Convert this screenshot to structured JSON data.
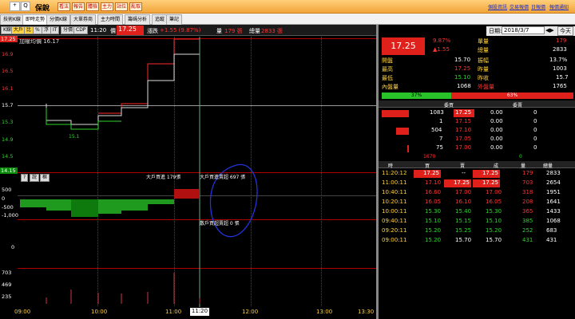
{
  "top": {
    "stock_ctrl": "+",
    "search": "Q",
    "name": "保銳",
    "fn_buttons": [
      "看法",
      "報告",
      "體檢",
      "主力",
      "站位",
      "亂取"
    ],
    "links": [
      "個股資訊",
      "交易報價",
      "日報價",
      "報價通知"
    ]
  },
  "tabs": [
    "技術K線",
    "即時走勢",
    "分價K線",
    "大單券商",
    "主力時間",
    "籌碼分析",
    "追蹤",
    "筆記"
  ],
  "toolbar": {
    "k": "K線",
    "big": "大戶",
    "ratio": "比",
    "pct": "%",
    "float": "浮",
    "price": "IT",
    "split": "分價",
    "cdp": "CDP",
    "time": "11:20",
    "price_lbl": "價",
    "price_val": "17.25",
    "chg_lbl": "漲跌",
    "chg_val": "+1.55 (9.87%)",
    "vol_lbl": "量",
    "vol_val": "179 張",
    "tot_lbl": "總量",
    "tot_val": "2833 張"
  },
  "chart": {
    "price_axis": [
      "17.25",
      "16.9",
      "16.5",
      "16.1",
      "15.7",
      "15.3",
      "14.9",
      "14.5",
      "14.15"
    ],
    "avg_label": "加權均價 16.17",
    "low_mark": "15.1",
    "mid_buttons": [
      "?",
      "說",
      "框"
    ],
    "bigbuy": "大戶買進 179張",
    "bigsell": "大戶買進賣超 697 張",
    "retail": "散戶買超賣超 0 張",
    "mid_axis": [
      "500",
      "0",
      "-500",
      "-1,000"
    ],
    "retail_axis": "0",
    "vol_axis": [
      "703",
      "469",
      "235"
    ],
    "time_ticks": [
      "09:00",
      "10:00",
      "11:00",
      "11:20",
      "12:00",
      "13:00",
      "13:30"
    ],
    "time_tag": "11:20"
  },
  "right": {
    "date_lbl": "日期:",
    "date": "2018/3/7",
    "today": "今天",
    "big_price": "17.25",
    "pct": "9.87%",
    "chg": "▲1.55",
    "vol_lbl": "單量",
    "vol": "179",
    "tot_lbl": "總量",
    "tot": "2833",
    "stats": [
      [
        "開盤",
        "15.70",
        "振幅",
        "13.7%"
      ],
      [
        "最高",
        "17.25",
        "昨量",
        "1003"
      ],
      [
        "最低",
        "15.10",
        "昨收",
        "15.7"
      ],
      [
        "內盤量",
        "1068",
        "外盤量",
        "1765"
      ]
    ],
    "inout": {
      "in": "37%",
      "out": "63%"
    },
    "ob_head": [
      "委買",
      "委賣"
    ],
    "orderbook": [
      [
        "1083",
        "17.25",
        "0.00",
        "0"
      ],
      [
        "1",
        "17.15",
        "0.00",
        "0"
      ],
      [
        "504",
        "17.10",
        "0.00",
        "0"
      ],
      [
        "7",
        "17.05",
        "0.00",
        "0"
      ],
      [
        "75",
        "17.00",
        "0.00",
        "0"
      ]
    ],
    "ob_total": {
      "buy": "1670",
      "sell": "0"
    },
    "tick_head": [
      "時",
      "買",
      "賣",
      "成",
      "量",
      "總量"
    ],
    "ticks": [
      [
        "11:20:12",
        "17.25",
        "--",
        "17.25",
        "179",
        "2833"
      ],
      [
        "11:00:11",
        "17.10",
        "17.25",
        "17.25",
        "703",
        "2654"
      ],
      [
        "10:40:11",
        "16.60",
        "17.00",
        "17.00",
        "318",
        "1951"
      ],
      [
        "10:20:11",
        "16.05",
        "16.10",
        "16.05",
        "208",
        "1641"
      ],
      [
        "10:00:11",
        "15.30",
        "15.40",
        "15.30",
        "365",
        "1433"
      ],
      [
        "09:40:11",
        "15.10",
        "15.15",
        "15.10",
        "385",
        "1068"
      ],
      [
        "09:20:11",
        "15.20",
        "15.25",
        "15.20",
        "252",
        "683"
      ],
      [
        "09:00:11",
        "15.20",
        "15.70",
        "15.70",
        "431",
        "431"
      ]
    ]
  }
}
